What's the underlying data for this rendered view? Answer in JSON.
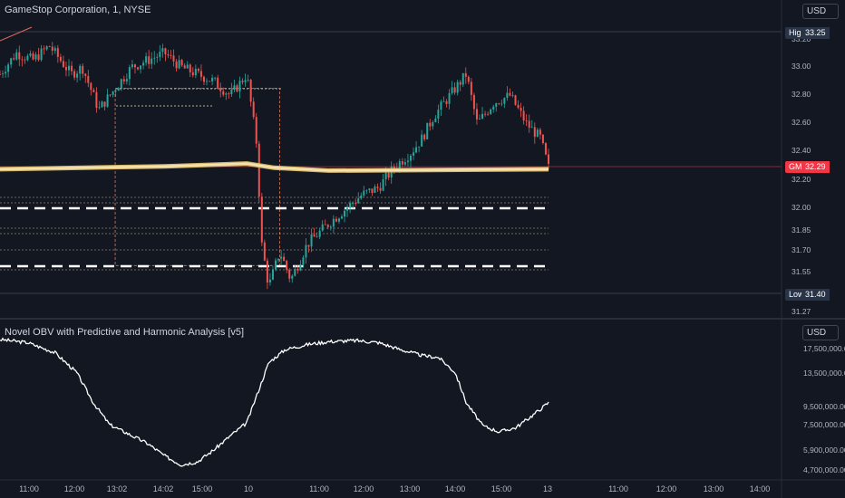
{
  "header": {
    "symbol_title": "GameStop Corporation, 1, NYSE",
    "currency": "USD"
  },
  "indicator": {
    "title": "Novel OBV with Predictive and Harmonic Analysis [v5]",
    "currency": "USD"
  },
  "tags": {
    "high_label": "High",
    "high_value": "33.25",
    "symbol_label": "GME",
    "last_value": "32.29",
    "low_label": "Low",
    "low_value": "31.40"
  },
  "colors": {
    "background": "#131722",
    "up": "#26a69a",
    "down": "#ef5350",
    "ma": "#f3e1b0",
    "grid": "#2a2e39",
    "obv": "#ffffff",
    "price_tag": "#f23645",
    "hl_tag": "#2a3447"
  },
  "chart_data": [
    {
      "type": "candlestick",
      "title": "GameStop Corporation, 1, NYSE",
      "y_ticks": [
        "33.20",
        "33.00",
        "32.80",
        "32.60",
        "32.40",
        "32.20",
        "32.00",
        "31.85",
        "31.70",
        "31.55",
        "31.27"
      ],
      "ylim": [
        31.27,
        33.25
      ],
      "x_ticks": [
        "11:00",
        "12:00",
        "13:02",
        "14:02",
        "15:00",
        "10",
        "11:00",
        "12:00",
        "13:00",
        "14:00",
        "15:00",
        "13",
        "11:00",
        "12:00",
        "13:00",
        "14:00"
      ],
      "high": 33.25,
      "low": 31.4,
      "last": 32.29,
      "close_path": [
        [
          0,
          32.95
        ],
        [
          0.03,
          33.1
        ],
        [
          0.06,
          33.05
        ],
        [
          0.09,
          33.15
        ],
        [
          0.11,
          33.05
        ],
        [
          0.13,
          32.95
        ],
        [
          0.15,
          33.0
        ],
        [
          0.18,
          32.7
        ],
        [
          0.21,
          32.85
        ],
        [
          0.24,
          33.0
        ],
        [
          0.27,
          33.05
        ],
        [
          0.3,
          33.1
        ],
        [
          0.33,
          33.0
        ],
        [
          0.36,
          32.95
        ],
        [
          0.39,
          32.9
        ],
        [
          0.42,
          32.8
        ],
        [
          0.45,
          32.95
        ],
        [
          0.47,
          32.4
        ],
        [
          0.475,
          31.8
        ],
        [
          0.49,
          31.45
        ],
        [
          0.51,
          31.7
        ],
        [
          0.53,
          31.5
        ],
        [
          0.56,
          31.75
        ],
        [
          0.6,
          31.9
        ],
        [
          0.63,
          32.0
        ],
        [
          0.66,
          32.1
        ],
        [
          0.69,
          32.15
        ],
        [
          0.72,
          32.3
        ],
        [
          0.75,
          32.4
        ],
        [
          0.77,
          32.5
        ],
        [
          0.79,
          32.65
        ],
        [
          0.82,
          32.8
        ],
        [
          0.85,
          32.95
        ],
        [
          0.87,
          32.6
        ],
        [
          0.9,
          32.75
        ],
        [
          0.93,
          32.8
        ],
        [
          0.96,
          32.6
        ],
        [
          0.985,
          32.5
        ],
        [
          1.0,
          32.29
        ]
      ],
      "moving_average": [
        [
          0,
          32.28
        ],
        [
          0.3,
          32.3
        ],
        [
          0.45,
          32.32
        ],
        [
          0.5,
          32.29
        ],
        [
          0.6,
          32.27
        ],
        [
          1.0,
          32.28
        ]
      ],
      "support_resistance_dashed": [
        32.0,
        31.6
      ],
      "boxes": [
        {
          "x0": 0.21,
          "x1": 0.51,
          "y_top": 32.85,
          "y_bottom": 31.6
        }
      ]
    },
    {
      "type": "line",
      "title": "Novel OBV with Predictive and Harmonic Analysis [v5]",
      "y_ticks": [
        "17,500,000.00",
        "13,500,000.00",
        "9,500,000.00",
        "7,500,000.00",
        "5,900,000.00",
        "4,700,000.00"
      ],
      "series": [
        {
          "values": [
            [
              0,
              17.8
            ],
            [
              0.05,
              17.5
            ],
            [
              0.1,
              16.5
            ],
            [
              0.14,
              14.5
            ],
            [
              0.17,
              11.5
            ],
            [
              0.2,
              9.3
            ],
            [
              0.23,
              8.5
            ],
            [
              0.27,
              7.4
            ],
            [
              0.3,
              6.2
            ],
            [
              0.33,
              5.3
            ],
            [
              0.36,
              5.6
            ],
            [
              0.39,
              6.8
            ],
            [
              0.42,
              8.2
            ],
            [
              0.45,
              9.5
            ],
            [
              0.47,
              12.5
            ],
            [
              0.49,
              15.5
            ],
            [
              0.52,
              16.8
            ],
            [
              0.56,
              17.3
            ],
            [
              0.6,
              17.6
            ],
            [
              0.65,
              17.7
            ],
            [
              0.69,
              17.5
            ],
            [
              0.73,
              16.8
            ],
            [
              0.77,
              16.2
            ],
            [
              0.8,
              16.0
            ],
            [
              0.83,
              14.5
            ],
            [
              0.85,
              11.5
            ],
            [
              0.88,
              9.2
            ],
            [
              0.91,
              8.6
            ],
            [
              0.94,
              9.0
            ],
            [
              0.97,
              10.2
            ],
            [
              1.0,
              11.5
            ]
          ]
        }
      ]
    }
  ]
}
